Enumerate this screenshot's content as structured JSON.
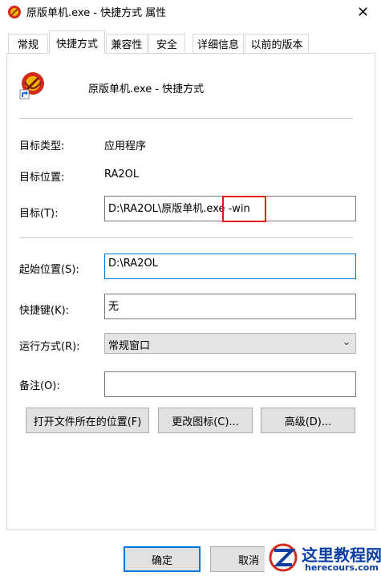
{
  "window": {
    "title": "原版单机.exe - 快捷方式 属性",
    "close_glyph": "✕"
  },
  "tabs": [
    {
      "label": "常规",
      "active": false
    },
    {
      "label": "快捷方式",
      "active": true
    },
    {
      "label": "兼容性",
      "active": false
    },
    {
      "label": "安全",
      "active": false
    },
    {
      "label": "详细信息",
      "active": false
    },
    {
      "label": "以前的版本",
      "active": false
    }
  ],
  "header": {
    "shortcut_name": "原版单机.exe - 快捷方式"
  },
  "fields": {
    "target_type_label": "目标类型:",
    "target_type_value": "应用程序",
    "target_location_label": "目标位置:",
    "target_location_value": "RA2OL",
    "target_label": "目标(T):",
    "target_value": "D:\\RA2OL\\原版单机.exe -win",
    "start_in_label": "起始位置(S):",
    "start_in_value": "D:\\RA2OL",
    "shortcut_key_label": "快捷键(K):",
    "shortcut_key_value": "无",
    "run_label": "运行方式(R):",
    "run_value": "常规窗口",
    "comment_label": "备注(O):",
    "comment_value": ""
  },
  "buttons": {
    "open_location": "打开文件所在的位置(F)",
    "change_icon": "更改图标(C)...",
    "advanced": "高级(D)...",
    "ok": "确定",
    "cancel": "取消"
  },
  "watermark": {
    "name": "这里教程网",
    "url": "herecours.com"
  },
  "colors": {
    "accent": "#0078d7",
    "highlight": "#e11919",
    "watermark": "#0a3ea1"
  }
}
